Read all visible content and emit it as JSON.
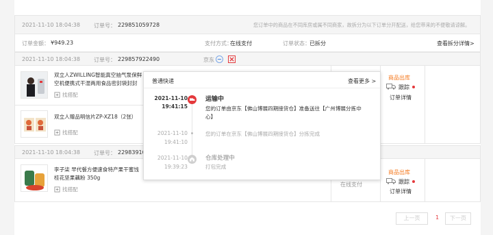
{
  "order_group": {
    "datetime": "2021-11-10 18:04:38",
    "order_label": "订单号：",
    "order_no": "229851059728",
    "split_notice": "您订单中的商品在不同库房或属不同商家，故拆分为以下订单分开配送，给您带来的不便敬请谅解。",
    "amount_label": "订单金额：",
    "amount": "¥949.23",
    "pay_label": "支付方式：",
    "pay_value": "在线支付",
    "status_label": "订单状态：",
    "status_value": "已拆分",
    "detail_link": "查看拆分详情>"
  },
  "sub_order_1": {
    "datetime": "2021-11-10 18:04:38",
    "order_label": "订单号：",
    "order_no": "229857922490",
    "shop": "京东",
    "product1_name": "双立人ZWILLING智能真空抽气泵保鲜空机便携式干湿两用食品密封袋封...",
    "product1_name_line1": "双立人ZWILLING智能真空抽气泵保鲜",
    "product1_name_line2": "空机便携式干湿两用食品密封袋封封",
    "find_similar": "找搭配",
    "product2_name": "双立人赠品明信片ZP-XZ18（2张）",
    "status_text": "商品出库",
    "track_label": "跟踪",
    "order_detail": "订单详情"
  },
  "sub_order_2": {
    "datetime": "2021-11-10 18:04:38",
    "order_label": "订单号：",
    "order_no": "22983910",
    "product_name_line1": "李子柒 早代餐方便速食特产果干蜜饯",
    "product_name_line2": "桂花坚果藕粉 350g",
    "find_similar": "找搭配",
    "pay_value": "在线支付",
    "status_text": "商品出库",
    "track_label": "跟踪",
    "order_detail": "订单详情"
  },
  "popup": {
    "title": "普通快递",
    "more_link": "查看更多 >",
    "events": [
      {
        "date": "2021-11-10",
        "time": "19:41:15",
        "title": "运输中",
        "text": "您的订单由京东【佛山博展四期接货仓】准备送往【广州博展分拣中心】",
        "text_l1": "您的订单由京东【佛山博展四期接货仓】准备送往【广州博展分拣中",
        "text_l2": "心】"
      },
      {
        "date": "2021-11-10",
        "time": "19:41:10",
        "title": "",
        "text": "您的订单在京东【佛山博展四期接货仓】分拣完成"
      },
      {
        "date": "2021-11-10",
        "time": "19:39:23",
        "title": "仓库处理中",
        "text": "打包完成"
      }
    ]
  },
  "pagination": {
    "prev": "上一页",
    "current": "1",
    "next": "下一页"
  },
  "colors": {
    "accent_red": "#e4393c",
    "orange": "#f57b22",
    "border": "#e6e6e6"
  }
}
